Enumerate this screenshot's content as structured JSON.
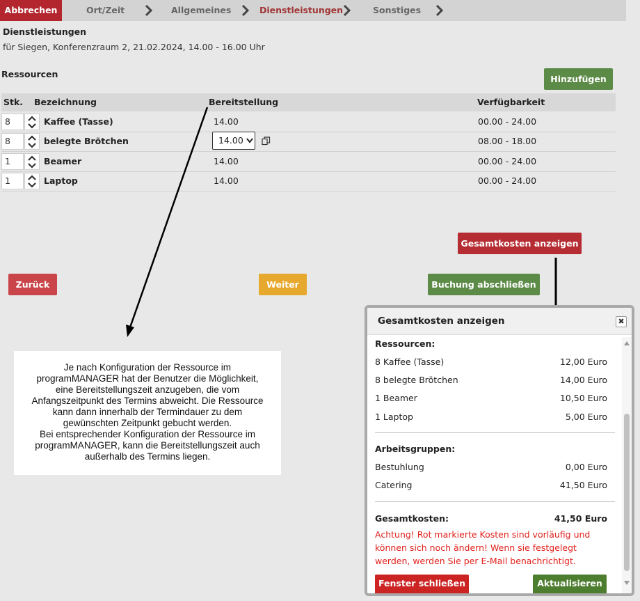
{
  "wizard": {
    "cancel_label": "Abbrechen",
    "steps": [
      "Ort/Zeit",
      "Allgemeines",
      "Dienstleistungen",
      "Sonstiges"
    ]
  },
  "section": {
    "title": "Dienstleistungen",
    "subtitle": "für Siegen, Konferenzraum 2, 21.02.2024, 14.00 - 16.00 Uhr"
  },
  "resources": {
    "title": "Ressourcen",
    "add_label": "Hinzufügen",
    "columns": [
      "Stk.",
      "Bezeichnung",
      "Bereitstellung",
      "Verfügbarkeit"
    ],
    "rows": [
      {
        "qty": "8",
        "name": "Kaffee (Tasse)",
        "time": "14.00",
        "avail": "00.00 - 24.00"
      },
      {
        "qty": "8",
        "name": "belegte Brötchen",
        "time": "14.00",
        "avail": "08.00 - 18.00"
      },
      {
        "qty": "1",
        "name": "Beamer",
        "time": "14.00",
        "avail": "00.00 - 24.00"
      },
      {
        "qty": "1",
        "name": "Laptop",
        "time": "14.00",
        "avail": "00.00 - 24.00"
      }
    ]
  },
  "actions": {
    "show_total": "Gesamtkosten anzeigen",
    "back": "Zurück",
    "next": "Weiter",
    "finish": "Buchung abschließen"
  },
  "note": {
    "lines": [
      "Je nach Konfiguration der Ressource im",
      "programMANAGER hat der Benutzer die Möglichkeit,",
      "eine Bereitstellungszeit anzugeben, die vom",
      "Anfangszeitpunkt des Termins abweicht. Die Ressource",
      "kann dann innerhalb der Termindauer zu dem",
      "gewünschten Zeitpunkt gebucht werden.",
      "Bei entsprechender Konfiguration der Ressource im",
      "programMANAGER, kann die Bereitstellungszeit auch",
      "außerhalb des Termins liegen."
    ]
  },
  "modal": {
    "title": "Gesamtkosten anzeigen",
    "resources_header": "Ressourcen:",
    "resources": [
      {
        "label": "8 Kaffee (Tasse)",
        "amount": "12,00 Euro"
      },
      {
        "label": "8 belegte Brötchen",
        "amount": "14,00 Euro"
      },
      {
        "label": "1 Beamer",
        "amount": "10,50 Euro"
      },
      {
        "label": "1 Laptop",
        "amount": "5,00 Euro"
      }
    ],
    "groups_header": "Arbeitsgruppen:",
    "groups": [
      {
        "label": "Bestuhlung",
        "amount": "0,00 Euro"
      },
      {
        "label": "Catering",
        "amount": "41,50 Euro"
      }
    ],
    "total_label": "Gesamtkosten:",
    "total_amount": "41,50 Euro",
    "warning": "Achtung! Rot markierte Kosten sind vorläufig und können sich noch ändern! Wenn sie festgelegt werden, werden Sie per E-Mail benachrichtigt.",
    "close_label": "Fenster schließen",
    "update_label": "Aktualisieren"
  },
  "colors": {
    "cancel": "#b3262e",
    "active_step": "#a13535",
    "green": "#5c8a47",
    "red": "#c9454a",
    "yellow": "#e6a82d",
    "warning": "#e1211d"
  }
}
